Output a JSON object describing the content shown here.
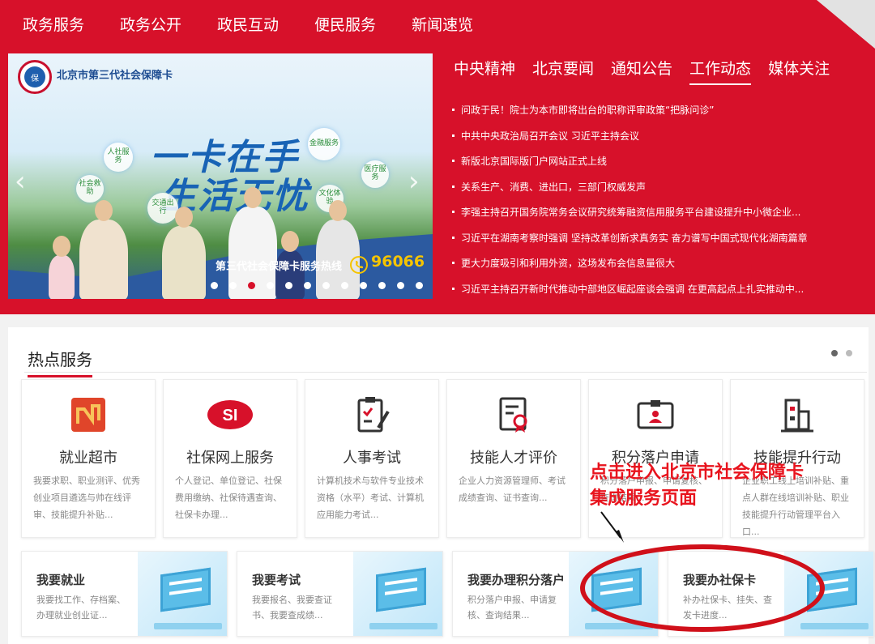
{
  "nav": {
    "items": [
      "政务服务",
      "政务公开",
      "政民互动",
      "便民服务",
      "新闻速览"
    ]
  },
  "banner": {
    "card_name": "北京市第三代社会保障卡",
    "logo_text": "保",
    "slogan_line1": "一卡在手",
    "slogan_line2": "生活无忧",
    "bubbles": [
      "人社服务",
      "金融服务",
      "社会救助",
      "医疗服务",
      "交通出行",
      "文化体验"
    ],
    "hotline_label": "第三代社会保障卡服务热线",
    "hotline_number": "96066",
    "prev_arrow": "‹",
    "next_arrow": "›",
    "slide_count": 12,
    "active_slide": 3
  },
  "news": {
    "tabs": [
      "中央精神",
      "北京要闻",
      "通知公告",
      "工作动态",
      "媒体关注"
    ],
    "active_tab": "工作动态",
    "items": [
      "问政于民！院士为本市即将出台的职称评审政策“把脉问诊”",
      "中共中央政治局召开会议 习近平主持会议",
      "新版北京国际版门户网站正式上线",
      "关系生产、消费、进出口，三部门权威发声",
      "李强主持召开国务院常务会议研究统筹融资信用服务平台建设提升中小微企业...",
      "习近平在湖南考察时强调 坚持改革创新求真务实 奋力谱写中国式现代化湖南篇章",
      "更大力度吸引和利用外资，这场发布会信息量很大",
      "习近平主持召开新时代推动中部地区崛起座谈会强调 在更高起点上扎实推动中..."
    ]
  },
  "hot": {
    "title": "热点服务",
    "cards": [
      {
        "title": "就业超市",
        "desc": "我要求职、职业测评、优秀创业项目遴选与帅在线评审、技能提升补贴..."
      },
      {
        "title": "社保网上服务",
        "desc": "个人登记、单位登记、社保费用缴纳、社保待遇查询、社保卡办理..."
      },
      {
        "title": "人事考试",
        "desc": "计算机技术与软件专业技术资格（水平）考试、计算机应用能力考试..."
      },
      {
        "title": "技能人才评价",
        "desc": "企业人力资源管理师、考试成绩查询、证书查询..."
      },
      {
        "title": "积分落户申请",
        "desc": "积分落户申报、申请复核、查询结果..."
      },
      {
        "title": "技能提升行动",
        "desc": "企业职工线上培训补贴、重点人群在线培训补贴、职业技能提升行动管理平台入口..."
      }
    ],
    "tiles": [
      {
        "title": "我要就业",
        "desc": "我要找工作、存档案、办理就业创业证..."
      },
      {
        "title": "我要考试",
        "desc": "我要报名、我要查证书、我要查成绩..."
      },
      {
        "title": "我要办理积分落户",
        "desc": "积分落户申报、申请复核、查询结果..."
      },
      {
        "title": "我要办社保卡",
        "desc": "补办社保卡、挂失、查发卡进度..."
      }
    ]
  },
  "annotation": {
    "line1": "点击进入北京市社会保障卡",
    "line2": "集成服务页面"
  },
  "colors": {
    "brand_red": "#d7112a",
    "annotation_red": "#e8141e",
    "banner_blue": "#1863b5"
  }
}
